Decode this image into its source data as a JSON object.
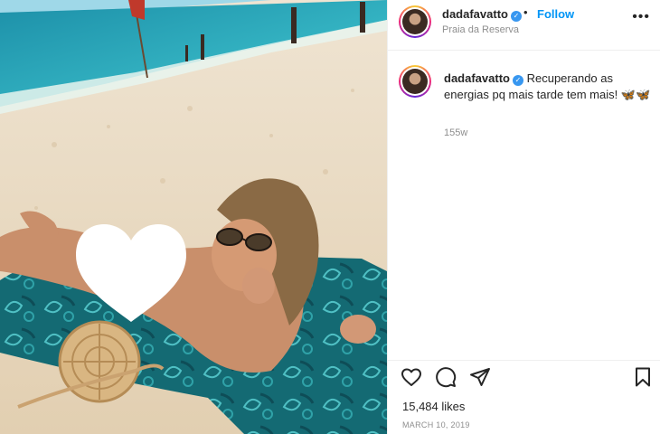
{
  "post": {
    "username": "dadafavatto",
    "verified": true,
    "follow_label": "Follow",
    "separator": "•",
    "location": "Praia da Reserva",
    "more_label": "•••",
    "caption": {
      "username": "dadafavatto",
      "text": "Recuperando as energias pq mais tarde tem mais! 🦋🦋"
    },
    "age": "155w",
    "likes": "15,484 likes",
    "date": "MARCH 10, 2019"
  },
  "icons": {
    "like": "heart-icon",
    "comment": "comment-icon",
    "share": "share-icon",
    "save": "bookmark-icon",
    "verified": "verified-badge-icon",
    "more": "more-options-icon"
  },
  "colors": {
    "accent": "#0095f6",
    "verified": "#3897f0",
    "muted": "#8e8e8e",
    "text": "#262626"
  }
}
